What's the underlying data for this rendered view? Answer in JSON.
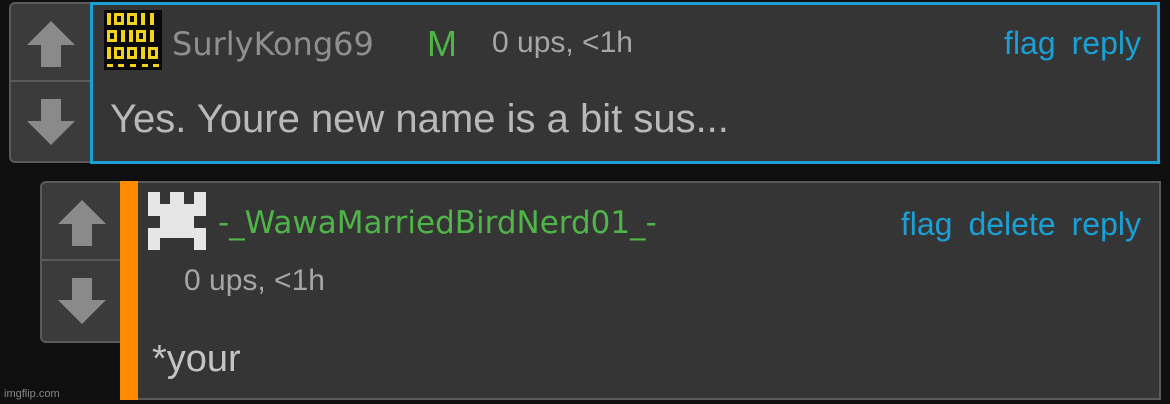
{
  "comments": [
    {
      "username": "SurlyKong69",
      "badge": "M",
      "meta": "0 ups, <1h",
      "actions": [
        "flag",
        "reply"
      ],
      "text": "Yes. Youre new name is a bit sus...",
      "avatar": "binary-code-icon"
    },
    {
      "username": "-_WawaMarriedBirdNerd01_-",
      "meta": "0 ups, <1h",
      "actions": [
        "flag",
        "delete",
        "reply"
      ],
      "text": "*your",
      "avatar": "pixel-glyph-icon"
    }
  ],
  "watermark": "imgflip.com",
  "colors": {
    "accent": "#1aa0d4",
    "username_green": "#4fb548",
    "op_bar": "#ff8c00",
    "panel": "#353535",
    "background": "#0f0f0f"
  }
}
